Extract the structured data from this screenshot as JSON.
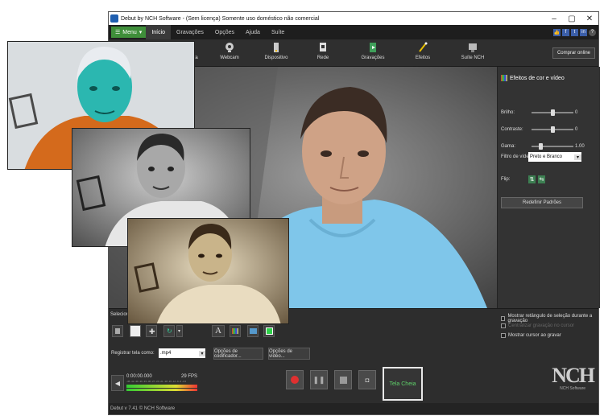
{
  "window": {
    "title": "Debut by NCH Software - (Sem licença) Somente uso doméstico não comercial",
    "controls": [
      "–",
      "▢",
      "✕"
    ]
  },
  "menubar": {
    "menu_button": "Menu",
    "items": [
      "Início",
      "Gravações",
      "Opções",
      "Ajuda",
      "Suíte"
    ],
    "active": "Início"
  },
  "toolbar": {
    "tools": [
      {
        "label": "Câmera",
        "icon": "camera-icon"
      },
      {
        "label": "Webcam",
        "icon": "webcam-icon"
      },
      {
        "label": "Dispositivo",
        "icon": "device-icon"
      },
      {
        "label": "Rede",
        "icon": "network-icon"
      },
      {
        "label": "Gravações",
        "icon": "recordings-icon"
      },
      {
        "label": "Efeitos",
        "icon": "effects-icon"
      },
      {
        "label": "Suíte NCH",
        "icon": "suite-icon"
      }
    ],
    "buy_label": "Comprar online"
  },
  "effects_panel": {
    "heading": "Efeitos de cor e vídeo",
    "brightness": {
      "label": "Brilho:",
      "value": "0",
      "level": 0.5
    },
    "contrast": {
      "label": "Contraste:",
      "value": "0",
      "level": 0.5
    },
    "gamma": {
      "label": "Gama:",
      "value": "1.00",
      "level": 0.2
    },
    "filter_label": "Filtro de vídeo:",
    "filter_value": "Preto e Branco",
    "flip_label": "Flip:",
    "reset_label": "Redefinir Padrões"
  },
  "bottom": {
    "select_label": "Seleciona",
    "record_as_label": "Registrar tela como:",
    "format_value": ".mp4",
    "encoder_options": "Opções de codificador...",
    "video_options": "Opções de vídeo...",
    "time": "0:00:00.000",
    "fps": "29 FPS",
    "meter_ticks": "-45 -42 -39 -36 -33 -30 -27 -24 -21 -18 -15 -12 -9 -6 -3 0",
    "fullscreen_label": "Tela Cheia",
    "checkboxes": [
      {
        "label": "Mostrar retângulo de seleção durante a gravação",
        "enabled": true
      },
      {
        "label": "Centralizar gravação no cursor",
        "enabled": false
      },
      {
        "label": "Mostrar cursor ao gravar",
        "enabled": true
      }
    ],
    "nch_logo": "NCH",
    "nch_sub": "NCH Software"
  },
  "statusbar": {
    "text": "Debut v 7.41 © NCH Software"
  },
  "colors": {
    "accent_green": "#3f8f3a",
    "record_red": "#e03030",
    "shirt_blue": "#7fc6ea",
    "sepia": "#c9b48a",
    "cyan_invert": "#2bb7b0"
  }
}
